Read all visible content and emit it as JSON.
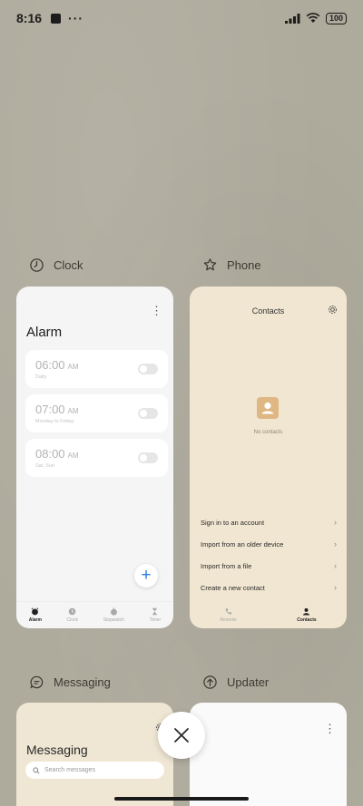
{
  "status_bar": {
    "time": "8:16",
    "dots": "···",
    "battery": "100"
  },
  "apps": {
    "clock": {
      "label": "Clock",
      "icon": "clock-icon"
    },
    "phone": {
      "label": "Phone",
      "icon": "phone-icon"
    },
    "messaging": {
      "label": "Messaging",
      "icon": "messaging-icon"
    },
    "updater": {
      "label": "Updater",
      "icon": "updater-icon"
    }
  },
  "clock_card": {
    "title": "Alarm",
    "menu": "⋮",
    "alarms": [
      {
        "time": "06:00",
        "ampm": "AM",
        "sub": "Daily"
      },
      {
        "time": "07:00",
        "ampm": "AM",
        "sub": "Monday to Friday"
      },
      {
        "time": "08:00",
        "ampm": "AM",
        "sub": "Sat, Sun"
      }
    ],
    "fab": "+",
    "nav": [
      {
        "label": "Alarm",
        "icon": "alarm-icon",
        "active": true
      },
      {
        "label": "Clock",
        "icon": "clock-icon",
        "active": false
      },
      {
        "label": "Stopwatch",
        "icon": "stopwatch-icon",
        "active": false
      },
      {
        "label": "Timer",
        "icon": "timer-icon",
        "active": false
      }
    ]
  },
  "contacts_card": {
    "title": "Contacts",
    "empty_text": "No contacts",
    "options": [
      "Sign in to an account",
      "Import from an older device",
      "Import from a file",
      "Create a new contact"
    ],
    "nav": [
      {
        "label": "Recents",
        "icon": "recents-icon",
        "active": false
      },
      {
        "label": "Contacts",
        "icon": "contacts-icon",
        "active": true
      }
    ]
  },
  "messaging_card": {
    "title": "Messaging",
    "search_placeholder": "Search messages"
  },
  "updater_card": {
    "menu": "⋮"
  },
  "colors": {
    "wallpaper": "#aeaa9c",
    "accent": "#2a7de1",
    "contacts_card_bg": "#f1e6d1",
    "avatar": "#dfb782"
  }
}
